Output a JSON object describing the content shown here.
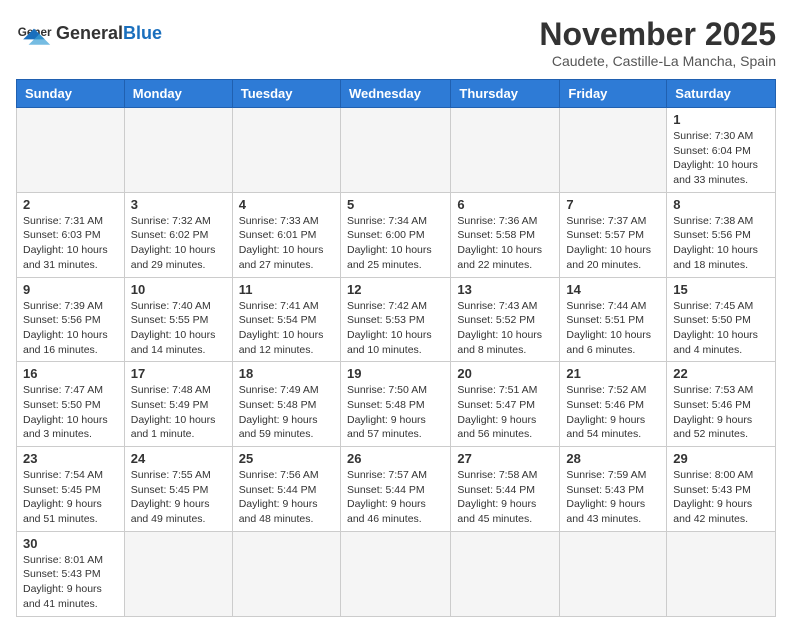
{
  "header": {
    "logo_general": "General",
    "logo_blue": "Blue",
    "month_title": "November 2025",
    "location": "Caudete, Castille-La Mancha, Spain"
  },
  "weekdays": [
    "Sunday",
    "Monday",
    "Tuesday",
    "Wednesday",
    "Thursday",
    "Friday",
    "Saturday"
  ],
  "weeks": [
    [
      {
        "day": "",
        "info": ""
      },
      {
        "day": "",
        "info": ""
      },
      {
        "day": "",
        "info": ""
      },
      {
        "day": "",
        "info": ""
      },
      {
        "day": "",
        "info": ""
      },
      {
        "day": "",
        "info": ""
      },
      {
        "day": "1",
        "info": "Sunrise: 7:30 AM\nSunset: 6:04 PM\nDaylight: 10 hours and 33 minutes."
      }
    ],
    [
      {
        "day": "2",
        "info": "Sunrise: 7:31 AM\nSunset: 6:03 PM\nDaylight: 10 hours and 31 minutes."
      },
      {
        "day": "3",
        "info": "Sunrise: 7:32 AM\nSunset: 6:02 PM\nDaylight: 10 hours and 29 minutes."
      },
      {
        "day": "4",
        "info": "Sunrise: 7:33 AM\nSunset: 6:01 PM\nDaylight: 10 hours and 27 minutes."
      },
      {
        "day": "5",
        "info": "Sunrise: 7:34 AM\nSunset: 6:00 PM\nDaylight: 10 hours and 25 minutes."
      },
      {
        "day": "6",
        "info": "Sunrise: 7:36 AM\nSunset: 5:58 PM\nDaylight: 10 hours and 22 minutes."
      },
      {
        "day": "7",
        "info": "Sunrise: 7:37 AM\nSunset: 5:57 PM\nDaylight: 10 hours and 20 minutes."
      },
      {
        "day": "8",
        "info": "Sunrise: 7:38 AM\nSunset: 5:56 PM\nDaylight: 10 hours and 18 minutes."
      }
    ],
    [
      {
        "day": "9",
        "info": "Sunrise: 7:39 AM\nSunset: 5:56 PM\nDaylight: 10 hours and 16 minutes."
      },
      {
        "day": "10",
        "info": "Sunrise: 7:40 AM\nSunset: 5:55 PM\nDaylight: 10 hours and 14 minutes."
      },
      {
        "day": "11",
        "info": "Sunrise: 7:41 AM\nSunset: 5:54 PM\nDaylight: 10 hours and 12 minutes."
      },
      {
        "day": "12",
        "info": "Sunrise: 7:42 AM\nSunset: 5:53 PM\nDaylight: 10 hours and 10 minutes."
      },
      {
        "day": "13",
        "info": "Sunrise: 7:43 AM\nSunset: 5:52 PM\nDaylight: 10 hours and 8 minutes."
      },
      {
        "day": "14",
        "info": "Sunrise: 7:44 AM\nSunset: 5:51 PM\nDaylight: 10 hours and 6 minutes."
      },
      {
        "day": "15",
        "info": "Sunrise: 7:45 AM\nSunset: 5:50 PM\nDaylight: 10 hours and 4 minutes."
      }
    ],
    [
      {
        "day": "16",
        "info": "Sunrise: 7:47 AM\nSunset: 5:50 PM\nDaylight: 10 hours and 3 minutes."
      },
      {
        "day": "17",
        "info": "Sunrise: 7:48 AM\nSunset: 5:49 PM\nDaylight: 10 hours and 1 minute."
      },
      {
        "day": "18",
        "info": "Sunrise: 7:49 AM\nSunset: 5:48 PM\nDaylight: 9 hours and 59 minutes."
      },
      {
        "day": "19",
        "info": "Sunrise: 7:50 AM\nSunset: 5:48 PM\nDaylight: 9 hours and 57 minutes."
      },
      {
        "day": "20",
        "info": "Sunrise: 7:51 AM\nSunset: 5:47 PM\nDaylight: 9 hours and 56 minutes."
      },
      {
        "day": "21",
        "info": "Sunrise: 7:52 AM\nSunset: 5:46 PM\nDaylight: 9 hours and 54 minutes."
      },
      {
        "day": "22",
        "info": "Sunrise: 7:53 AM\nSunset: 5:46 PM\nDaylight: 9 hours and 52 minutes."
      }
    ],
    [
      {
        "day": "23",
        "info": "Sunrise: 7:54 AM\nSunset: 5:45 PM\nDaylight: 9 hours and 51 minutes."
      },
      {
        "day": "24",
        "info": "Sunrise: 7:55 AM\nSunset: 5:45 PM\nDaylight: 9 hours and 49 minutes."
      },
      {
        "day": "25",
        "info": "Sunrise: 7:56 AM\nSunset: 5:44 PM\nDaylight: 9 hours and 48 minutes."
      },
      {
        "day": "26",
        "info": "Sunrise: 7:57 AM\nSunset: 5:44 PM\nDaylight: 9 hours and 46 minutes."
      },
      {
        "day": "27",
        "info": "Sunrise: 7:58 AM\nSunset: 5:44 PM\nDaylight: 9 hours and 45 minutes."
      },
      {
        "day": "28",
        "info": "Sunrise: 7:59 AM\nSunset: 5:43 PM\nDaylight: 9 hours and 43 minutes."
      },
      {
        "day": "29",
        "info": "Sunrise: 8:00 AM\nSunset: 5:43 PM\nDaylight: 9 hours and 42 minutes."
      }
    ],
    [
      {
        "day": "30",
        "info": "Sunrise: 8:01 AM\nSunset: 5:43 PM\nDaylight: 9 hours and 41 minutes."
      },
      {
        "day": "",
        "info": ""
      },
      {
        "day": "",
        "info": ""
      },
      {
        "day": "",
        "info": ""
      },
      {
        "day": "",
        "info": ""
      },
      {
        "day": "",
        "info": ""
      },
      {
        "day": "",
        "info": ""
      }
    ]
  ]
}
